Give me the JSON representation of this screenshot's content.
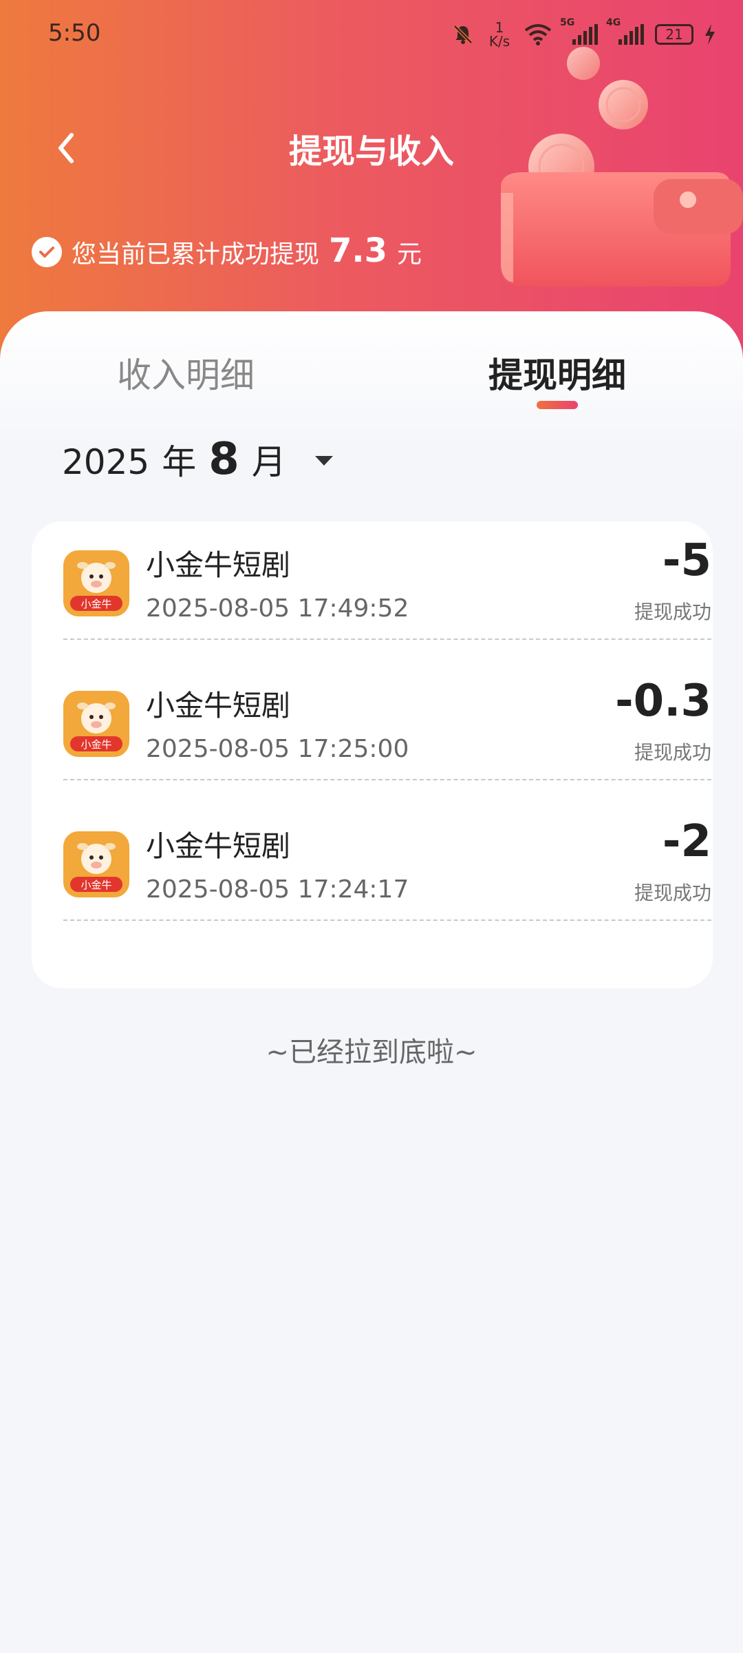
{
  "status_bar": {
    "time": "5:50",
    "net_speed_value": "1",
    "net_speed_unit": "K/s",
    "sim1_label": "5G",
    "sim2_label": "4G",
    "battery": "21"
  },
  "header": {
    "title": "提现与收入",
    "summary_prefix": "您当前已累计成功提现",
    "summary_amount": "7.3",
    "summary_unit": "元"
  },
  "tabs": [
    {
      "label": "收入明细",
      "active": false
    },
    {
      "label": "提现明细",
      "active": true
    }
  ],
  "month_picker": {
    "year": "2025",
    "year_unit": "年",
    "month": "8",
    "month_unit": "月"
  },
  "records": [
    {
      "name": "小金牛短剧",
      "time": "2025-08-05 17:49:52",
      "amount": "-5",
      "status": "提现成功"
    },
    {
      "name": "小金牛短剧",
      "time": "2025-08-05 17:25:00",
      "amount": "-0.3",
      "status": "提现成功"
    },
    {
      "name": "小金牛短剧",
      "time": "2025-08-05 17:24:17",
      "amount": "-2",
      "status": "提现成功"
    }
  ],
  "app_icon_text": "小金牛",
  "footer_note": "~已经拉到底啦~",
  "colors": {
    "header_start": "#ee7a3e",
    "header_end": "#e9436f",
    "text_primary": "#222222",
    "text_secondary": "#666666"
  }
}
